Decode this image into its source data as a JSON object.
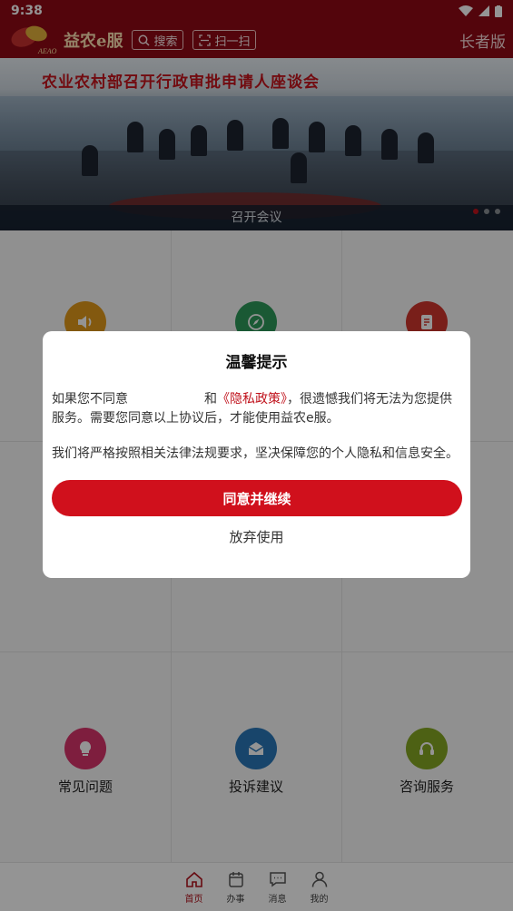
{
  "status_bar": {
    "time": "9:38"
  },
  "header": {
    "logo_sub": "AEAO",
    "brand": "益农e服",
    "search_label": "搜索",
    "scan_label": "扫一扫",
    "elder_mode_label": "长者版"
  },
  "banner": {
    "headline": "农业农村部召开行政审批申请人座谈会",
    "caption": "召开会议",
    "slide_count": 3,
    "active_slide": 1
  },
  "grid": {
    "bottom_row": [
      {
        "label": "常见问题",
        "icon": "lightbulb-icon",
        "color": "#d9346b"
      },
      {
        "label": "投诉建议",
        "icon": "mail-icon",
        "color": "#2a78b8"
      },
      {
        "label": "咨询服务",
        "icon": "headset-icon",
        "color": "#86a824"
      }
    ],
    "top_row_icons": [
      {
        "icon": "speaker-icon",
        "color": "#e29a1b"
      },
      {
        "icon": "compass-icon",
        "color": "#2e9a5a"
      },
      {
        "icon": "document-icon",
        "color": "#d0362e"
      }
    ]
  },
  "bottom_nav": {
    "items": [
      {
        "label": "首页",
        "icon": "home-icon",
        "active": true
      },
      {
        "label": "办事",
        "icon": "calendar-icon",
        "active": false
      },
      {
        "label": "消息",
        "icon": "message-icon",
        "active": false
      },
      {
        "label": "我的",
        "icon": "user-icon",
        "active": false
      }
    ]
  },
  "modal": {
    "title": "温馨提示",
    "para1_prefix": "如果您不同意",
    "para1_mid": "和",
    "privacy_link": "《隐私政策》",
    "para1_suffix": "，很遗憾我们将无法为您提供服务。需要您同意以上协议后，才能使用益农e服。",
    "para2": "我们将严格按照相关法律法规要求，坚决保障您的个人隐私和信息安全。",
    "agree_label": "同意并继续",
    "reject_label": "放弃使用"
  },
  "colors": {
    "primary": "#8f0a15",
    "accent": "#d0101c"
  }
}
